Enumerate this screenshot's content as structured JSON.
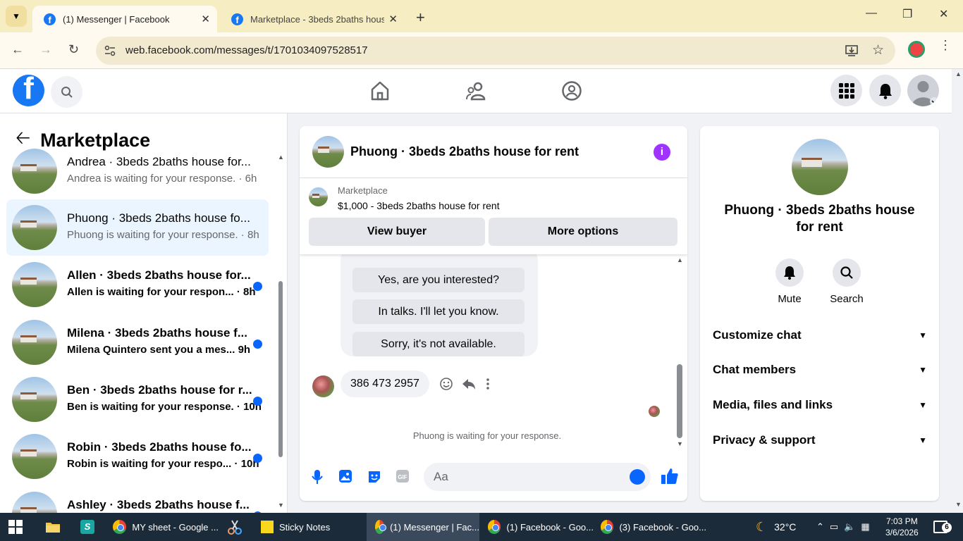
{
  "browser": {
    "tabs": [
      {
        "title": "(1) Messenger | Facebook",
        "active": true
      },
      {
        "title": "Marketplace - 3beds 2baths house",
        "active": false
      }
    ],
    "url": "web.facebook.com/messages/t/1701034097528517"
  },
  "left": {
    "title": "Marketplace",
    "conversations": [
      {
        "name": "Andrea · 3beds 2baths house for...",
        "sub": "Andrea is waiting for your response.",
        "time": "6h",
        "unread": false,
        "selected": false
      },
      {
        "name": "Phuong · 3beds 2baths house fo...",
        "sub": "Phuong is waiting for your response.",
        "time": "8h",
        "unread": false,
        "selected": true
      },
      {
        "name": "Allen · 3beds 2baths house for...",
        "sub": "Allen is waiting for your respon...",
        "time": "8h",
        "unread": true,
        "selected": false
      },
      {
        "name": "Milena · 3beds 2baths house f...",
        "sub": "Milena Quintero sent you a mes...",
        "time": "9h",
        "unread": true,
        "selected": false
      },
      {
        "name": "Ben · 3beds 2baths house for r...",
        "sub": "Ben is waiting for your response.",
        "time": "10h",
        "unread": true,
        "selected": false
      },
      {
        "name": "Robin · 3beds 2baths house fo...",
        "sub": "Robin is waiting for your respo...",
        "time": "10h",
        "unread": true,
        "selected": false
      },
      {
        "name": "Ashley · 3beds 2baths house f...",
        "sub": "",
        "time": "",
        "unread": true,
        "selected": false
      }
    ]
  },
  "chat": {
    "title": "Phuong · 3beds 2baths house for rent",
    "marketplace_label": "Marketplace",
    "listing": "$1,000 - 3beds 2baths house for rent",
    "view_buyer": "View buyer",
    "more_options": "More options",
    "quick_replies": [
      "Yes, are you interested?",
      "In talks. I'll let you know.",
      "Sorry, it's not available."
    ],
    "message": "386 473 2957",
    "status": "Phuong is waiting for your response.",
    "composer_placeholder": "Aa"
  },
  "right": {
    "name": "Phuong · 3beds 2baths house for rent",
    "mute": "Mute",
    "search": "Search",
    "sections": [
      "Customize chat",
      "Chat members",
      "Media, files and links",
      "Privacy & support"
    ]
  },
  "taskbar": {
    "items": [
      "MY sheet - Google ...",
      "Sticky Notes",
      "(1) Messenger | Fac...",
      "(1) Facebook - Goo...",
      "(3) Facebook - Goo..."
    ],
    "temperature": "32°C",
    "time": "7:03 PM",
    "date": "3/6/2026",
    "notifications": "6"
  },
  "colors": {
    "accent": "#0866ff",
    "fb_blue": "#1877f2",
    "info": "#a033ff"
  }
}
